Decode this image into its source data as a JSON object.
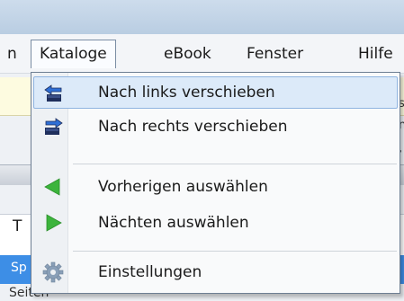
{
  "menubar": {
    "left_fragment": "n",
    "items": [
      "Kataloge",
      "eBook",
      "Fenster",
      "Hilfe"
    ]
  },
  "dropdown": {
    "items": [
      {
        "label": "Nach links verschieben",
        "icon": "move-left-icon",
        "highlighted": true
      },
      {
        "label": "Nach rechts verschieben",
        "icon": "move-right-icon",
        "highlighted": false
      },
      {
        "label": "Vorherigen auswählen",
        "icon": "triangle-left-icon",
        "highlighted": false
      },
      {
        "label": "Nächten auswählen",
        "icon": "triangle-right-icon",
        "highlighted": false
      },
      {
        "label": "Einstellungen",
        "icon": "gear-icon",
        "highlighted": false
      }
    ]
  },
  "background": {
    "left_t": "T",
    "left_sp": "Sp",
    "left_seiten": "Seiten",
    "right_s": "s",
    "right_n": "n",
    "right_comma": ","
  },
  "colors": {
    "highlight_bg": "#dceaf9",
    "selection_blue": "#3d8ee6",
    "green_arrow": "#3cb43c",
    "icon_navy": "#1f2f5c"
  }
}
